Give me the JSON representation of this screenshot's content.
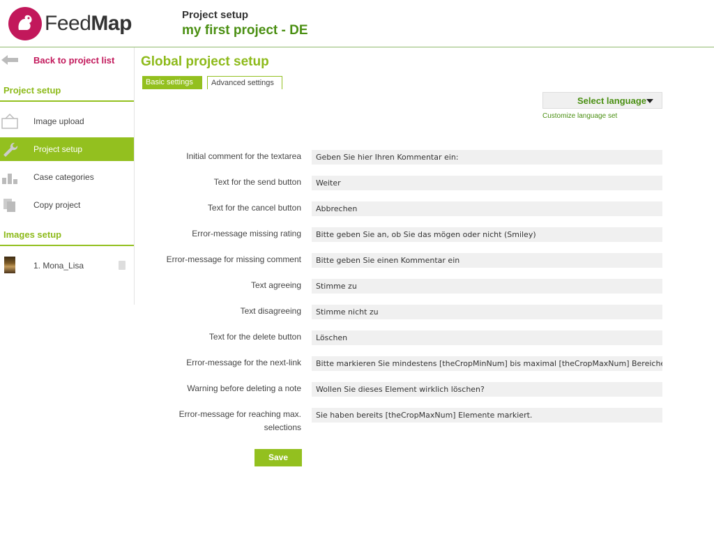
{
  "header": {
    "logo_text_1": "Feed",
    "logo_text_2": "Map",
    "subtitle": "Project setup",
    "title": "my first project - DE"
  },
  "sidebar": {
    "back_label": "Back to project list",
    "section_project": "Project setup",
    "items": [
      {
        "label": "Image upload",
        "icon": "frame-icon"
      },
      {
        "label": "Project setup",
        "icon": "wrench-icon",
        "active": true
      },
      {
        "label": "Case categories",
        "icon": "bar-chart-icon"
      },
      {
        "label": "Copy project",
        "icon": "copy-icon"
      }
    ],
    "section_images": "Images setup",
    "images": [
      {
        "label": "1. Mona_Lisa"
      }
    ]
  },
  "main": {
    "title": "Global project setup",
    "tabs": [
      {
        "label": "Basic settings",
        "active": true
      },
      {
        "label": "Advanced settings",
        "active": false
      }
    ],
    "language_button": "Select language",
    "customize_link": "Customize language set",
    "fields": [
      {
        "label": "Initial comment for the textarea",
        "value": "Geben Sie hier Ihren Kommentar ein:"
      },
      {
        "label": "Text for the send button",
        "value": "Weiter"
      },
      {
        "label": "Text for the cancel button",
        "value": "Abbrechen"
      },
      {
        "label": "Error-message missing rating",
        "value": "Bitte geben Sie an, ob Sie das mögen oder nicht (Smiley)"
      },
      {
        "label": "Error-message for missing comment",
        "value": "Bitte geben Sie einen Kommentar ein"
      },
      {
        "label": "Text agreeing",
        "value": "Stimme zu"
      },
      {
        "label": "Text disagreeing",
        "value": "Stimme nicht zu"
      },
      {
        "label": "Text for the delete button",
        "value": "Löschen"
      },
      {
        "label": "Error-message for the next-link",
        "value": "Bitte markieren Sie mindestens [theCropMinNum] bis maximal [theCropMaxNum] Bereiche. (s"
      },
      {
        "label": "Warning before deleting a note",
        "value": "Wollen Sie dieses Element wirklich löschen?"
      },
      {
        "label": "Error-message for reaching max. selections",
        "value": "Sie haben bereits [theCropMaxNum] Elemente markiert."
      }
    ],
    "save_label": "Save"
  },
  "colors": {
    "accent_green": "#93c01f",
    "dark_green": "#4a8f12",
    "brand_magenta": "#c2185b"
  }
}
